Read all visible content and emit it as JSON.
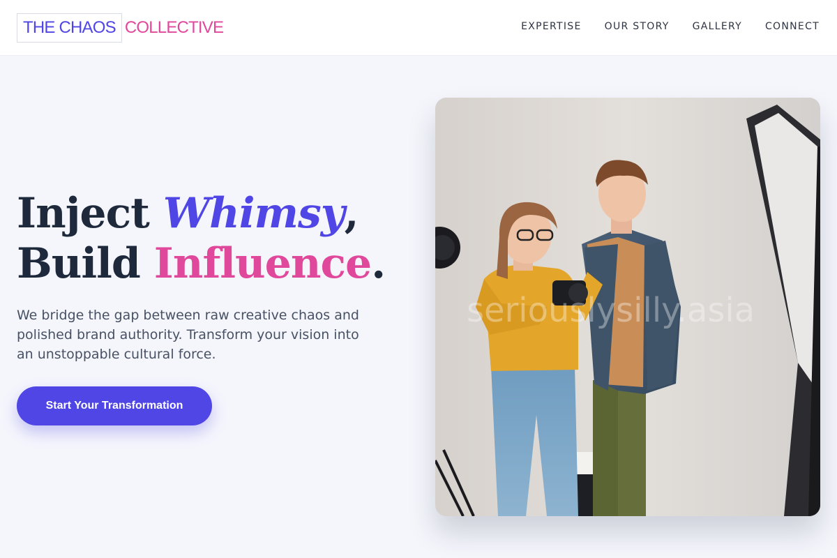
{
  "brand": {
    "logo_part1": "THE CHAOS",
    "logo_part2": "COLLECTIVE"
  },
  "nav": {
    "items": [
      "EXPERTISE",
      "OUR STORY",
      "GALLERY",
      "CONNECT"
    ]
  },
  "hero": {
    "line1_word1": "Inject",
    "line1_accent": "Whimsy",
    "line1_punct": ",",
    "line2_word1": "Build",
    "line2_accent": "Influence",
    "line2_punct": ".",
    "subtext": "We bridge the gap between raw creative chaos and polished brand authority. Transform your vision into an unstoppable cultural force.",
    "cta_label": "Start Your Transformation"
  },
  "image": {
    "watermark": "seriouslysilly.asia"
  },
  "colors": {
    "primary": "#4f46e5",
    "accent": "#e0489b",
    "dark": "#1e293b",
    "background": "#f5f6fc"
  }
}
